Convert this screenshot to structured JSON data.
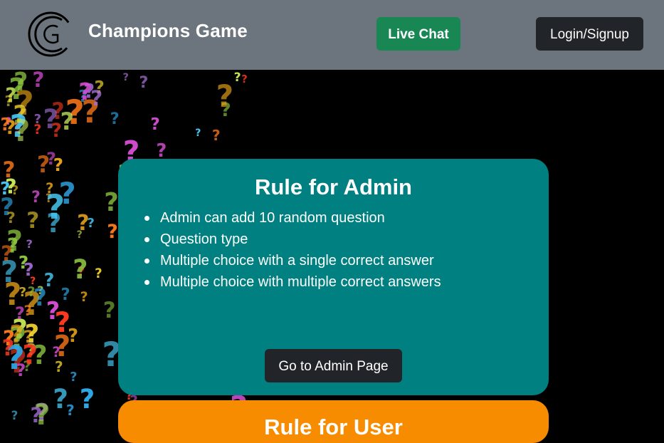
{
  "navbar": {
    "brand": "Champions Game",
    "logo_text": "CG",
    "live_chat_label": "Live Chat",
    "login_label": "Login/Signup"
  },
  "admin_card": {
    "title": "Rule for Admin",
    "rules": [
      "Admin can add 10 random question",
      "Question type",
      "Multiple choice with a single correct answer",
      "Multiple choice with multiple correct answers"
    ],
    "button_label": "Go to Admin Page",
    "color": "#008080"
  },
  "user_card": {
    "title": "Rule for User",
    "color": "#f78c00"
  },
  "colors": {
    "navbar": "#6c757d",
    "live_chat": "#198754",
    "dark_button": "#212529"
  },
  "background": {
    "glyph": "?"
  }
}
